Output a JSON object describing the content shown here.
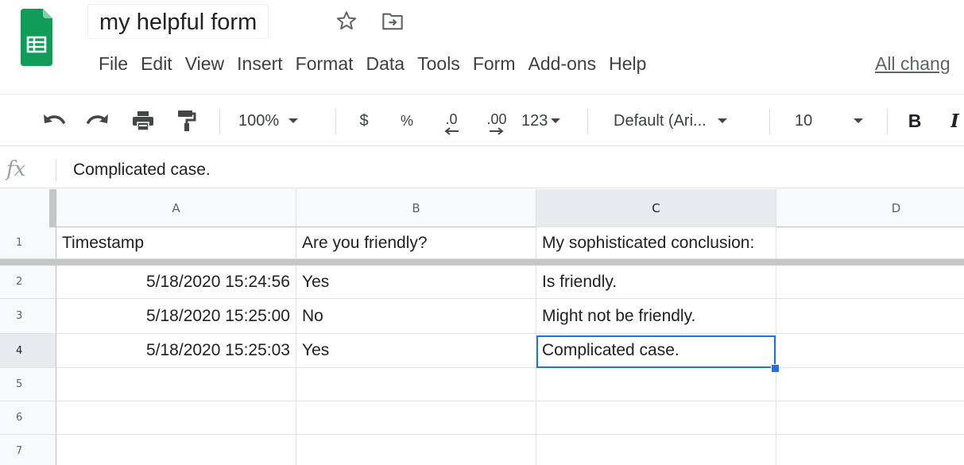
{
  "document": {
    "title": "my helpful form"
  },
  "menu": {
    "items": [
      "File",
      "Edit",
      "View",
      "Insert",
      "Format",
      "Data",
      "Tools",
      "Form",
      "Add-ons",
      "Help"
    ],
    "save_status": "All chang"
  },
  "toolbar": {
    "zoom": "100%",
    "currency": "$",
    "percent": "%",
    "decrease_decimal": ".0",
    "increase_decimal": ".00",
    "more_formats": "123",
    "font": "Default (Ari...",
    "font_size": "10",
    "bold": "B",
    "italic": "I"
  },
  "formula_bar": {
    "fx_label": "fx",
    "value": "Complicated case."
  },
  "sheet": {
    "columns": [
      "A",
      "B",
      "C",
      "D"
    ],
    "active_column": "C",
    "active_row": "4",
    "rows": [
      {
        "num": "1",
        "cells": [
          "Timestamp",
          "Are you friendly?",
          "My sophisticated conclusion:",
          ""
        ]
      },
      {
        "num": "2",
        "cells": [
          "5/18/2020 15:24:56",
          "Yes",
          "Is friendly.",
          ""
        ]
      },
      {
        "num": "3",
        "cells": [
          "5/18/2020 15:25:00",
          "No",
          "Might not be friendly.",
          ""
        ]
      },
      {
        "num": "4",
        "cells": [
          "5/18/2020 15:25:03",
          "Yes",
          "Complicated case.",
          ""
        ]
      },
      {
        "num": "5",
        "cells": [
          "",
          "",
          "",
          ""
        ]
      },
      {
        "num": "6",
        "cells": [
          "",
          "",
          "",
          ""
        ]
      },
      {
        "num": "7",
        "cells": [
          "",
          "",
          "",
          ""
        ]
      }
    ]
  },
  "colors": {
    "brand_green": "#0f9d58",
    "selection_blue": "#1a73e8"
  },
  "icons": [
    "sheets-logo-icon",
    "star-icon",
    "move-to-folder-icon",
    "undo-icon",
    "redo-icon",
    "print-icon",
    "paint-format-icon",
    "chevron-down-icon"
  ]
}
